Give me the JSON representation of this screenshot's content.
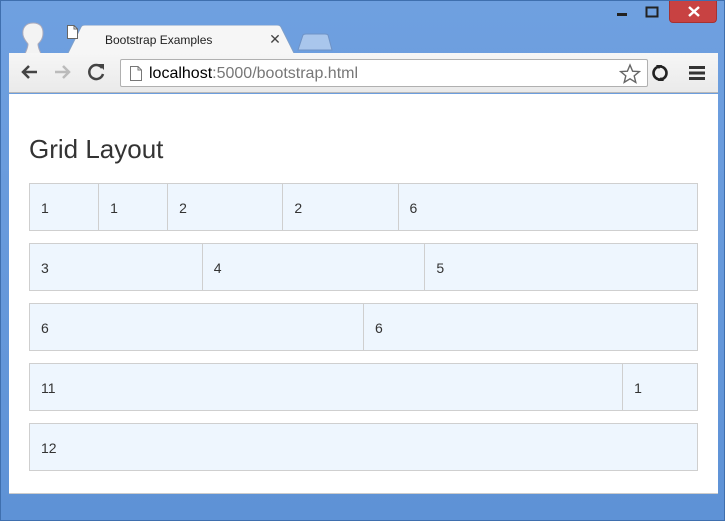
{
  "browser": {
    "tab": {
      "title": "Bootstrap Examples"
    },
    "address": {
      "host": "localhost",
      "rest": ":5000/bootstrap.html"
    },
    "icons": {
      "avatar": "user-avatar-icon",
      "back": "back-arrow-icon",
      "forward": "forward-arrow-icon",
      "reload": "reload-icon",
      "star": "star-icon",
      "menu": "hamburger-menu-icon"
    },
    "colors": {
      "frame": "#5e92d6",
      "close": "#c84242"
    }
  },
  "page": {
    "title": "Grid Layout",
    "grid": [
      [
        {
          "label": "1",
          "span": 1
        },
        {
          "label": "1",
          "span": 1
        },
        {
          "label": "2",
          "span": 2
        },
        {
          "label": "2",
          "span": 2
        },
        {
          "label": "6",
          "span": 6
        }
      ],
      [
        {
          "label": "3",
          "span": 3
        },
        {
          "label": "4",
          "span": 4
        },
        {
          "label": "5",
          "span": 5
        }
      ],
      [
        {
          "label": "6",
          "span": 6
        },
        {
          "label": "6",
          "span": 6
        }
      ],
      [
        {
          "label": "11",
          "span": 11
        },
        {
          "label": "1",
          "span": 1
        }
      ],
      [
        {
          "label": "12",
          "span": 12
        }
      ]
    ],
    "colors": {
      "cell_bg": "#eef6fe",
      "cell_border": "#cfcfcf"
    }
  }
}
